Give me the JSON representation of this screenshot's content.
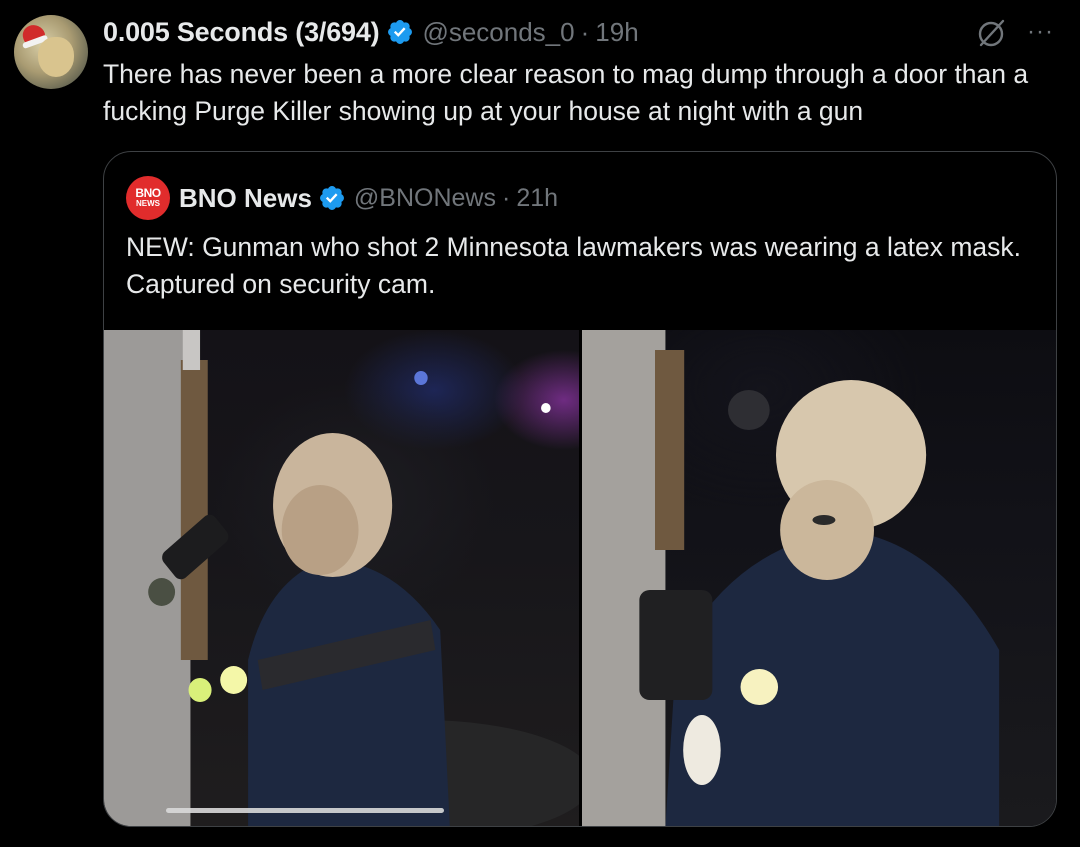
{
  "tweet": {
    "display_name": "0.005 Seconds (3/694)",
    "handle": "@seconds_0",
    "separator": "·",
    "time": "19h",
    "text": "There has never been a more clear reason to mag dump through a door than a fucking Purge Killer showing up at your house at night with a gun",
    "more_label": "···",
    "icons": {
      "avatar": "user-avatar",
      "verified": "verified-badge-icon",
      "grok": "grok-icon",
      "more": "more-options-icon"
    }
  },
  "quoted_tweet": {
    "logo_line1": "BNO",
    "logo_line2": "NEWS",
    "display_name": "BNO News",
    "handle": "@BNONews",
    "separator": "·",
    "time": "21h",
    "text": "NEW: Gunman who shot 2 Minnesota lawmakers was wearing a latex mask. Captured on security cam.",
    "media": [
      {
        "alt": "Security camera image of masked gunman holding a flashlight"
      },
      {
        "alt": "Security camera image of masked gunman at a doorway"
      }
    ]
  },
  "colors": {
    "background": "#000000",
    "text_primary": "#e7e9ea",
    "text_secondary": "#71767b",
    "verified_blue": "#1d9bf0",
    "border": "#3e4144",
    "bno_red": "#e12c2c"
  }
}
